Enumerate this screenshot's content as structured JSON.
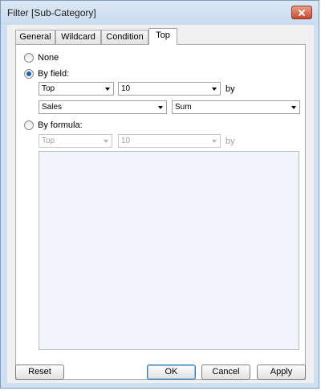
{
  "window": {
    "title": "Filter [Sub-Category]"
  },
  "tabs": [
    {
      "label": "General"
    },
    {
      "label": "Wildcard"
    },
    {
      "label": "Condition"
    },
    {
      "label": "Top"
    }
  ],
  "active_tab": "Top",
  "options": {
    "none_label": "None",
    "by_field_label": "By field:",
    "by_formula_label": "By formula:",
    "selected": "By field"
  },
  "by_field": {
    "direction": "Top",
    "count": "10",
    "by_label": "by",
    "field": "Sales",
    "aggregation": "Sum"
  },
  "by_formula": {
    "direction": "Top",
    "count": "10",
    "by_label": "by",
    "formula": ""
  },
  "buttons": {
    "reset": "Reset",
    "ok": "OK",
    "cancel": "Cancel",
    "apply": "Apply"
  },
  "colors": {
    "radio_selected": "#1f5fbf",
    "close_button": "#c8472b"
  }
}
